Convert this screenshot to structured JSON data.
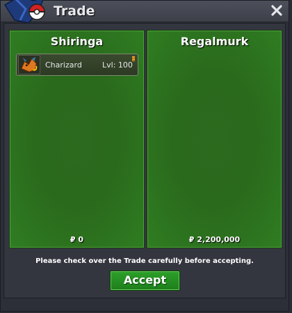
{
  "window": {
    "title": "Trade",
    "logo_icon": "pokeball-logo-icon",
    "close_icon": "close-icon"
  },
  "offers": [
    {
      "player": "Shiringa",
      "items": [
        {
          "name": "Charizard",
          "level": "Lvl: 100",
          "icon": "charizard-sprite-icon"
        }
      ],
      "money": "₽ 0"
    },
    {
      "player": "Regalmurk",
      "items": [],
      "money": "₽ 2,200,000"
    }
  ],
  "notice": "Please check over the Trade carefully before accepting.",
  "accept_label": "Accept",
  "colors": {
    "panel_green": "#2c6b1f",
    "accept_green": "#2da02a",
    "titlebar": "#454952"
  }
}
